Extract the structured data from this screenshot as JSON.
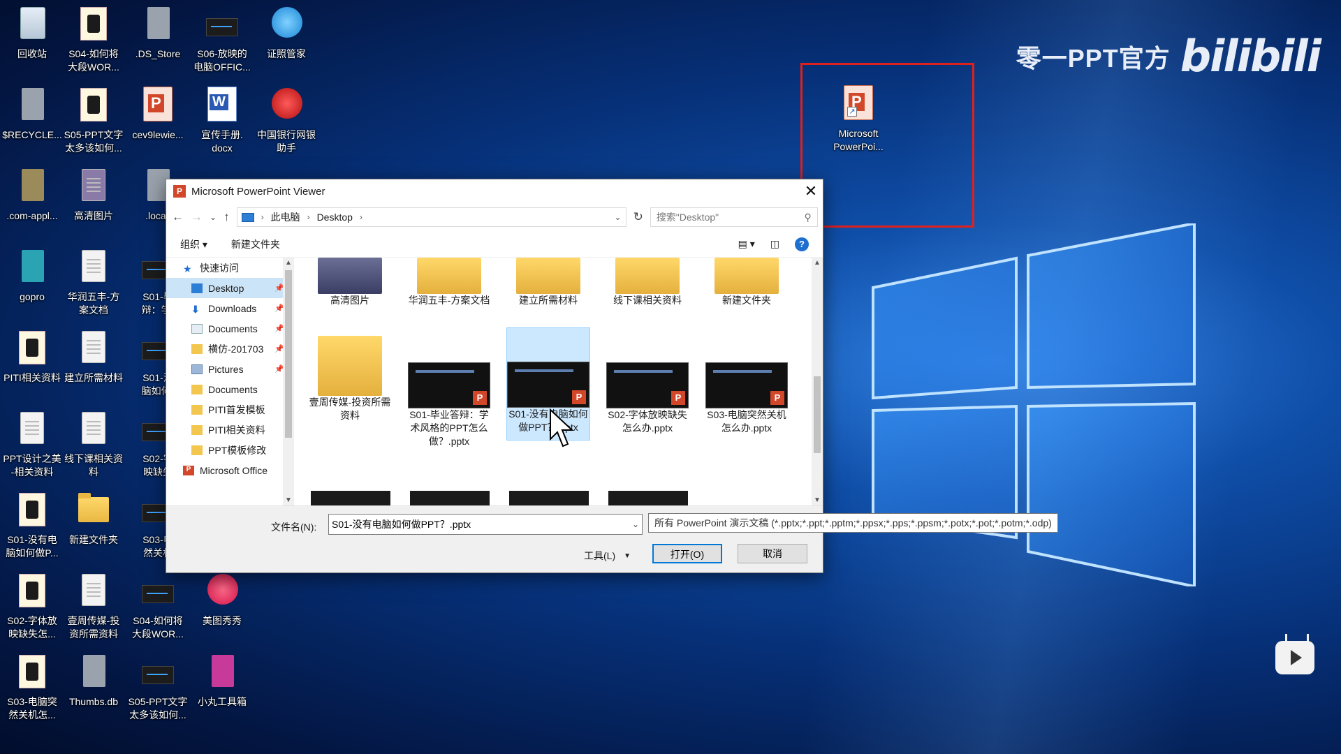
{
  "desktop": {
    "icons": [
      {
        "label": "回收站"
      },
      {
        "label": "S04-如何将\n大段WOR..."
      },
      {
        "label": ".DS_Store"
      },
      {
        "label": "S06-放映的\n电脑OFFIC..."
      },
      {
        "label": "证照管家"
      },
      {
        "label": "$RECYCLE..."
      },
      {
        "label": "S05-PPT文字\n太多该如何..."
      },
      {
        "label": "cev9lewie..."
      },
      {
        "label": "宣传手册.\ndocx"
      },
      {
        "label": "中国银行网银\n助手"
      },
      {
        "label": ".com-appl..."
      },
      {
        "label": "高清图片"
      },
      {
        "label": ".locali"
      },
      {
        "label": "gopro"
      },
      {
        "label": "华润五丰-方\n案文档"
      },
      {
        "label": "S01-毕\n辩：学-"
      },
      {
        "label": "PITI相关资料"
      },
      {
        "label": "建立所需材料"
      },
      {
        "label": "S01-没\n脑如何("
      },
      {
        "label": "PPT设计之美\n-相关资料"
      },
      {
        "label": "线下课相关资\n料"
      },
      {
        "label": "S02-字\n映缺失"
      },
      {
        "label": "S01-没有电\n脑如何做P..."
      },
      {
        "label": "新建文件夹"
      },
      {
        "label": "S03-电\n然关机"
      },
      {
        "label": "S02-字体放\n映缺失怎..."
      },
      {
        "label": "壹周传媒-投\n资所需资料"
      },
      {
        "label": "S04-如何将\n大段WOR..."
      },
      {
        "label": "美图秀秀"
      },
      {
        "label": "S03-电脑突\n然关机怎..."
      },
      {
        "label": "Thumbs.db"
      },
      {
        "label": "S05-PPT文字\n太多该如何..."
      },
      {
        "label": "小丸工具箱"
      },
      {
        "label": "Microsoft\nPowerPoi..."
      }
    ]
  },
  "watermark": {
    "text": "零一PPT官方",
    "logo": "bilibili"
  },
  "dialog": {
    "title": "Microsoft PowerPoint Viewer",
    "close": "✕",
    "breadcrumb": [
      "此电脑",
      "Desktop"
    ],
    "search_placeholder": "搜索\"Desktop\"",
    "toolbar": {
      "organize": "组织 ▾",
      "new_folder": "新建文件夹"
    },
    "nav": [
      {
        "label": "快速访问",
        "pin": ""
      },
      {
        "label": "Desktop",
        "pin": "📌"
      },
      {
        "label": "Downloads",
        "pin": "📌"
      },
      {
        "label": "Documents",
        "pin": "📌"
      },
      {
        "label": "横仿-201703",
        "pin": "📌"
      },
      {
        "label": "Pictures",
        "pin": "📌"
      },
      {
        "label": "Documents",
        "pin": ""
      },
      {
        "label": "PITI首发模板",
        "pin": ""
      },
      {
        "label": "PITI相关资料",
        "pin": ""
      },
      {
        "label": "PPT模板修改",
        "pin": ""
      },
      {
        "label": "Microsoft Office",
        "pin": ""
      }
    ],
    "files_row1": [
      "高清图片",
      "华润五丰-方案文档",
      "建立所需材料",
      "线下课相关资料",
      "新建文件夹"
    ],
    "files_row2": [
      {
        "label": "壹周传媒-投资所需资料"
      },
      {
        "label": "S01-毕业答辩：学术风格的PPT怎么做？.pptx"
      },
      {
        "label": "S01-没有电脑如何做PPT？.pptx"
      },
      {
        "label": "S02-字体放映缺失怎么办.pptx"
      },
      {
        "label": "S03-电脑突然关机怎么办.pptx"
      }
    ],
    "filename_label": "文件名(N):",
    "filename_value": "S01-没有电脑如何做PPT？.pptx",
    "filetype": "所有 PowerPoint 演示文稿 (*.pptx;*.ppt;*.pptm;*.ppsx;*.pps;*.ppsm;*.potx;*.pot;*.potm;*.odp)",
    "tools_label": "工具(L)",
    "open_label": "打开(O)",
    "cancel_label": "取消"
  },
  "colors": {
    "accent": "#0078d7",
    "highlight_box": "#e0201d",
    "selection": "#cce8ff"
  }
}
